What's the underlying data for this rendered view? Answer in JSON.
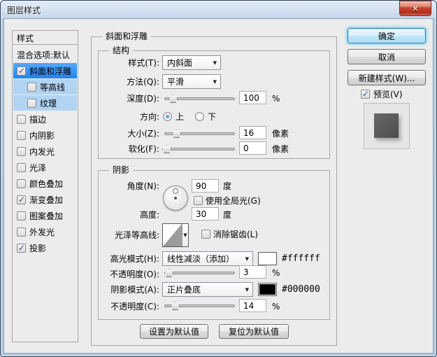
{
  "window": {
    "title": "图层样式"
  },
  "sidebar": {
    "header": "样式",
    "items": [
      {
        "key": "blending-options",
        "label": "混合选项:默认",
        "check": null,
        "state": ""
      },
      {
        "key": "bevel-emboss",
        "label": "斜面和浮雕",
        "check": true,
        "state": "selected"
      },
      {
        "key": "contour",
        "label": "等高线",
        "check": false,
        "state": "sub",
        "indent": true
      },
      {
        "key": "texture",
        "label": "纹理",
        "check": false,
        "state": "sub",
        "indent": true
      },
      {
        "key": "stroke",
        "label": "描边",
        "check": false,
        "state": ""
      },
      {
        "key": "inner-shadow",
        "label": "内阴影",
        "check": false,
        "state": ""
      },
      {
        "key": "inner-glow",
        "label": "内发光",
        "check": false,
        "state": ""
      },
      {
        "key": "satin",
        "label": "光泽",
        "check": false,
        "state": ""
      },
      {
        "key": "color-overlay",
        "label": "颜色叠加",
        "check": false,
        "state": ""
      },
      {
        "key": "gradient-overlay",
        "label": "渐变叠加",
        "check": true,
        "state": ""
      },
      {
        "key": "pattern-overlay",
        "label": "图案叠加",
        "check": false,
        "state": ""
      },
      {
        "key": "outer-glow",
        "label": "外发光",
        "check": false,
        "state": ""
      },
      {
        "key": "drop-shadow",
        "label": "投影",
        "check": true,
        "state": ""
      }
    ]
  },
  "main": {
    "title": "斜面和浮雕",
    "structure": {
      "title": "结构",
      "style_label": "样式(T):",
      "style_value": "内斜面",
      "method_label": "方法(Q):",
      "method_value": "平滑",
      "depth_label": "深度(D):",
      "depth_value": "100",
      "depth_unit": "%",
      "direction_label": "方向:",
      "direction_up": "上",
      "direction_down": "下",
      "direction_up_selected": true,
      "direction_down_selected": false,
      "size_label": "大小(Z):",
      "size_value": "16",
      "size_unit": "像素",
      "soften_label": "软化(F):",
      "soften_value": "0",
      "soften_unit": "像素"
    },
    "shading": {
      "title": "阴影",
      "angle_label": "角度(N):",
      "angle_value": "90",
      "angle_unit": "度",
      "use_global_light_label": "使用全局光(G)",
      "use_global_light": false,
      "altitude_label": "高度:",
      "altitude_value": "30",
      "altitude_unit": "度",
      "gloss_contour_label": "光泽等高线:",
      "anti_aliased_label": "消除锯齿(L)",
      "anti_aliased": false,
      "highlight_mode_label": "高光模式(H):",
      "highlight_mode_value": "线性减淡（添加）",
      "highlight_color": "#ffffff",
      "highlight_hex": "#ffffff",
      "highlight_opacity_label": "不透明度(O):",
      "highlight_opacity_value": "3",
      "highlight_opacity_unit": "%",
      "shadow_mode_label": "阴影模式(A):",
      "shadow_mode_value": "正片叠底",
      "shadow_color": "#000000",
      "shadow_hex": "#000000",
      "shadow_opacity_label": "不透明度(C):",
      "shadow_opacity_value": "14",
      "shadow_opacity_unit": "%"
    },
    "footer": {
      "set_default": "设置为默认值",
      "reset_default": "复位为默认值"
    }
  },
  "actions": {
    "ok": "确定",
    "cancel": "取消",
    "new_style": "新建样式(W)...",
    "preview_label": "预览(V)",
    "preview_checked": true
  }
}
